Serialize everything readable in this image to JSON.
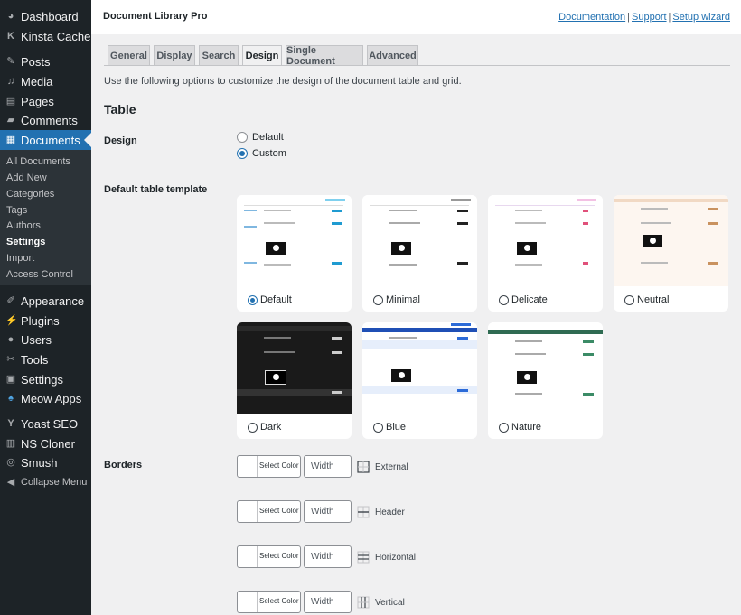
{
  "sidebar": {
    "items": [
      {
        "label": "Dashboard",
        "icon": "dashboard-icon"
      },
      {
        "label": "Kinsta Cache",
        "icon": "kinsta-icon"
      },
      {
        "label": "Posts",
        "icon": "pin-icon"
      },
      {
        "label": "Media",
        "icon": "media-icon"
      },
      {
        "label": "Pages",
        "icon": "pages-icon"
      },
      {
        "label": "Comments",
        "icon": "comment-icon"
      },
      {
        "label": "Documents",
        "icon": "document-icon"
      },
      {
        "label": "Appearance",
        "icon": "brush-icon"
      },
      {
        "label": "Plugins",
        "icon": "plugin-icon"
      },
      {
        "label": "Users",
        "icon": "user-icon"
      },
      {
        "label": "Tools",
        "icon": "wrench-icon"
      },
      {
        "label": "Settings",
        "icon": "settings-icon"
      },
      {
        "label": "Meow Apps",
        "icon": "meow-icon"
      },
      {
        "label": "Yoast SEO",
        "icon": "yoast-icon"
      },
      {
        "label": "NS Cloner",
        "icon": "cloner-icon"
      },
      {
        "label": "Smush",
        "icon": "smush-icon"
      },
      {
        "label": "Collapse Menu",
        "icon": "collapse-icon"
      }
    ],
    "submenu": [
      "All Documents",
      "Add New",
      "Categories",
      "Tags",
      "Authors",
      "Settings",
      "Import",
      "Access Control"
    ]
  },
  "header": {
    "title": "Document Library Pro",
    "links": [
      "Documentation",
      "Support",
      "Setup wizard"
    ],
    "separator": "|"
  },
  "tabs": [
    "General",
    "Display",
    "Search",
    "Design",
    "Single Document",
    "Advanced"
  ],
  "active_tab": "Design",
  "description": "Use the following options to customize the design of the document table and grid.",
  "section_title": "Table",
  "design": {
    "label": "Design",
    "options": [
      "Default",
      "Custom"
    ],
    "selected": "Custom"
  },
  "template": {
    "label": "Default table template",
    "options": [
      "Default",
      "Minimal",
      "Delicate",
      "Neutral",
      "Dark",
      "Blue",
      "Nature"
    ],
    "selected": "Default"
  },
  "borders": {
    "label": "Borders",
    "select_color_label": "Select Color",
    "width_placeholder": "Width",
    "rows": [
      "External",
      "Header",
      "Horizontal",
      "Vertical"
    ]
  },
  "colors": {
    "sidebar_bg": "#1d2327",
    "accent": "#2271b1",
    "page_bg": "#f0f0f1"
  }
}
